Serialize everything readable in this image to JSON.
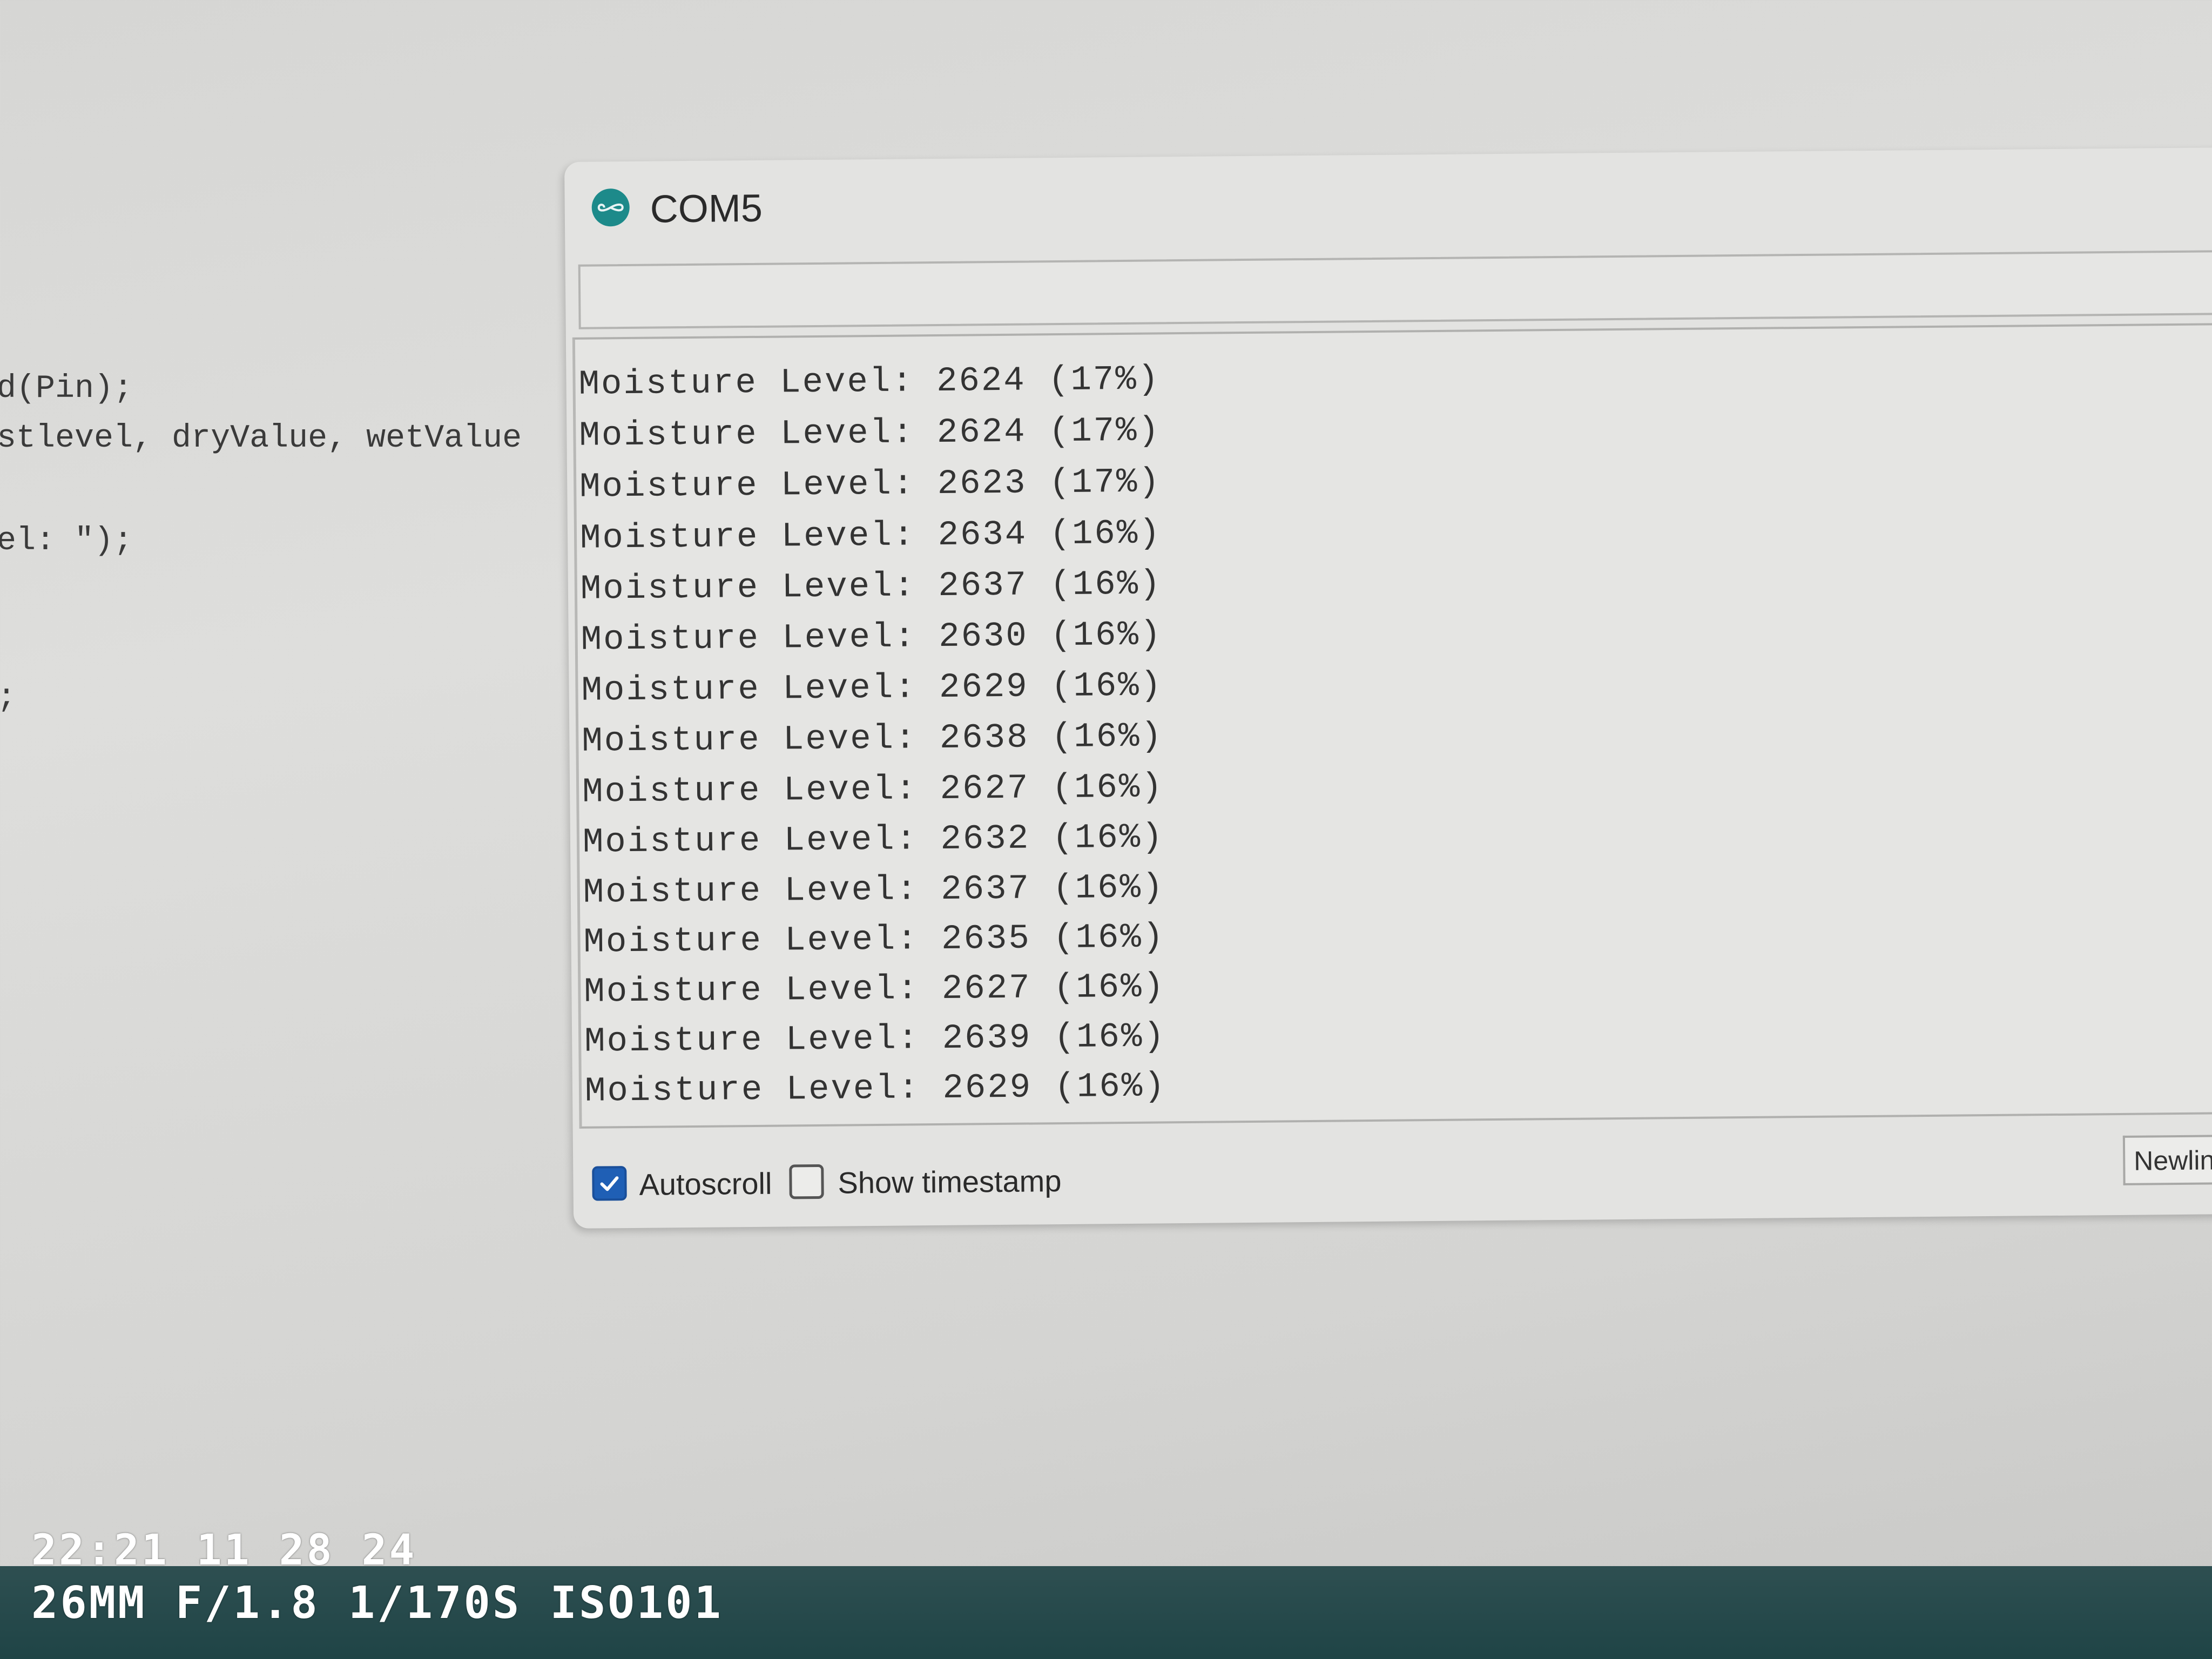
{
  "editor": {
    "code_lines": [
      "d(Pin);",
      "stlevel, dryValue, wetValue",
      "el: \");",
      ";"
    ]
  },
  "serial_monitor": {
    "title": "COM5",
    "icon": "arduino-infinity-icon",
    "send_input": {
      "value": "",
      "placeholder": ""
    },
    "output_lines": [
      "Moisture Level: 2624 (17%)",
      "Moisture Level: 2624 (17%)",
      "Moisture Level: 2623 (17%)",
      "Moisture Level: 2634 (16%)",
      "Moisture Level: 2637 (16%)",
      "Moisture Level: 2630 (16%)",
      "Moisture Level: 2629 (16%)",
      "Moisture Level: 2638 (16%)",
      "Moisture Level: 2627 (16%)",
      "Moisture Level: 2632 (16%)",
      "Moisture Level: 2637 (16%)",
      "Moisture Level: 2635 (16%)",
      "Moisture Level: 2627 (16%)",
      "Moisture Level: 2639 (16%)",
      "Moisture Level: 2629 (16%)"
    ],
    "autoscroll": {
      "label": "Autoscroll",
      "checked": true
    },
    "show_timestamp": {
      "label": "Show timestamp",
      "checked": false
    },
    "line_ending": "Newlin"
  },
  "camera_overlay": {
    "line1": "22:21 11 28 24",
    "line2": "26MM F/1.8 1/170S ISO101"
  },
  "colors": {
    "accent": "#1f5fb5",
    "icon_teal": "#1d8a8a",
    "overlay_bar": "#2e4f51"
  }
}
